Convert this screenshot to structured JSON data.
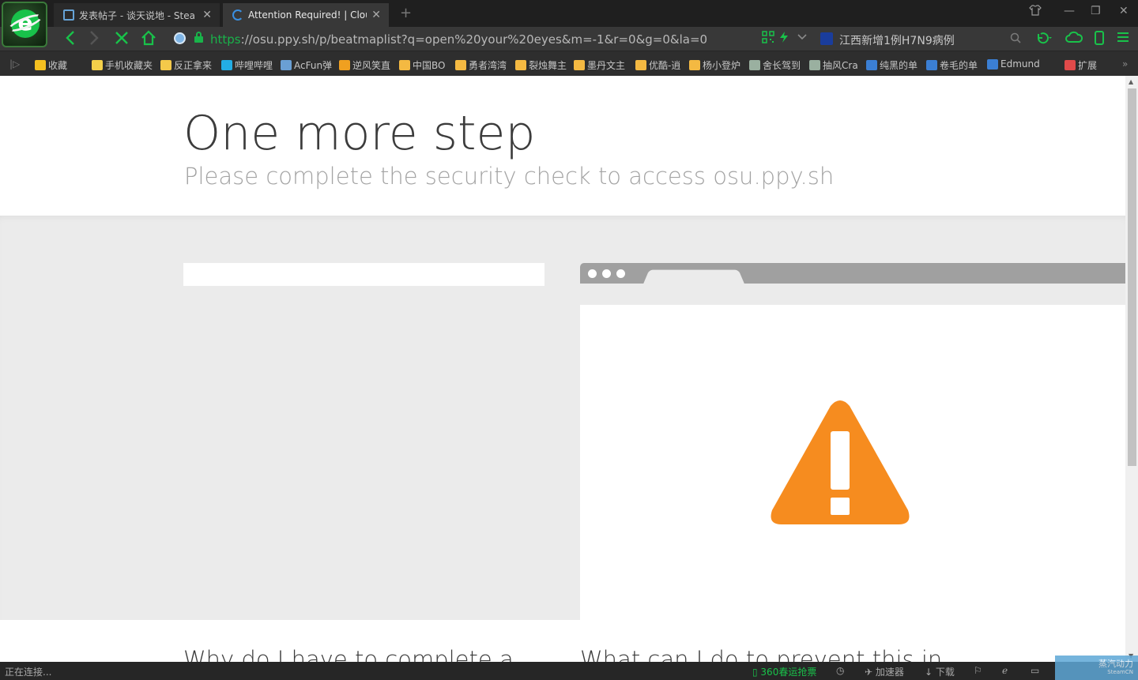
{
  "browser": {
    "tabs": [
      {
        "title": "发表帖子 - 谈天说地 - Stea",
        "active": false
      },
      {
        "title": "Attention Required! | Clou",
        "active": true
      }
    ],
    "new_tab": "+",
    "window_controls": {
      "skin": "skin-icon",
      "minimize": "—",
      "restore": "❐",
      "close": "✕"
    },
    "address": {
      "protocol": "https",
      "rest": "://osu.ppy.sh/p/beatmaplist?q=open%20your%20eyes&m=-1&r=0&g=0&la=0"
    },
    "search": {
      "text": "江西新增1例H7N9病例"
    },
    "bookmarks": [
      {
        "label": "收藏",
        "icon": "star-icon",
        "color": "#f4c020"
      },
      {
        "label": "手机收藏夹",
        "icon": "phone-icon",
        "color": "#f4d04a"
      },
      {
        "label": "反正拿来",
        "icon": "folder-icon",
        "color": "#f4c94a"
      },
      {
        "label": "哔哩哔哩",
        "icon": "tv-icon",
        "color": "#23ade5"
      },
      {
        "label": "AcFun弹",
        "icon": "acfun-icon",
        "color": "#6a9fd4"
      },
      {
        "label": "逆风笑直",
        "icon": "dy-icon",
        "color": "#f0a020"
      },
      {
        "label": "中国BO",
        "icon": "cat-icon",
        "color": "#f4b942"
      },
      {
        "label": "勇者湾湾",
        "icon": "cat-icon",
        "color": "#f4b942"
      },
      {
        "label": "裂烛舞主",
        "icon": "cat-icon",
        "color": "#f4b942"
      },
      {
        "label": "墨丹文主",
        "icon": "cat-icon",
        "color": "#f4b942"
      },
      {
        "label": "优酷-逍",
        "icon": "cat-icon",
        "color": "#f4b942"
      },
      {
        "label": "杨小登炉",
        "icon": "cat-icon",
        "color": "#f4b942"
      },
      {
        "label": "舍长驾到",
        "icon": "car-icon",
        "color": "#9ab0a0"
      },
      {
        "label": "抽风Cra",
        "icon": "car-icon",
        "color": "#9ab0a0"
      },
      {
        "label": "纯黑的单",
        "icon": "flag-icon",
        "color": "#3b7fd4"
      },
      {
        "label": "卷毛的单",
        "icon": "flag-icon",
        "color": "#3b7fd4"
      },
      {
        "label": "Edmund",
        "icon": "flag-icon",
        "color": "#3b7fd4"
      },
      {
        "label": "扩展",
        "icon": "extension-icon",
        "color": "#e04a4a"
      }
    ]
  },
  "page": {
    "title": "One more step",
    "subtitle": "Please complete the security check to access osu.ppy.sh",
    "heading_left": "Why do I have to complete a",
    "heading_right": "What can I do to prevent this in",
    "warning_color": "#f68c1f"
  },
  "status": {
    "left": "正在连接...",
    "ticket": "360春运抢票",
    "accelerator": "加速器",
    "download": "下载",
    "badge_main": "蒸汽动力",
    "badge_sub": "SteamCN"
  }
}
